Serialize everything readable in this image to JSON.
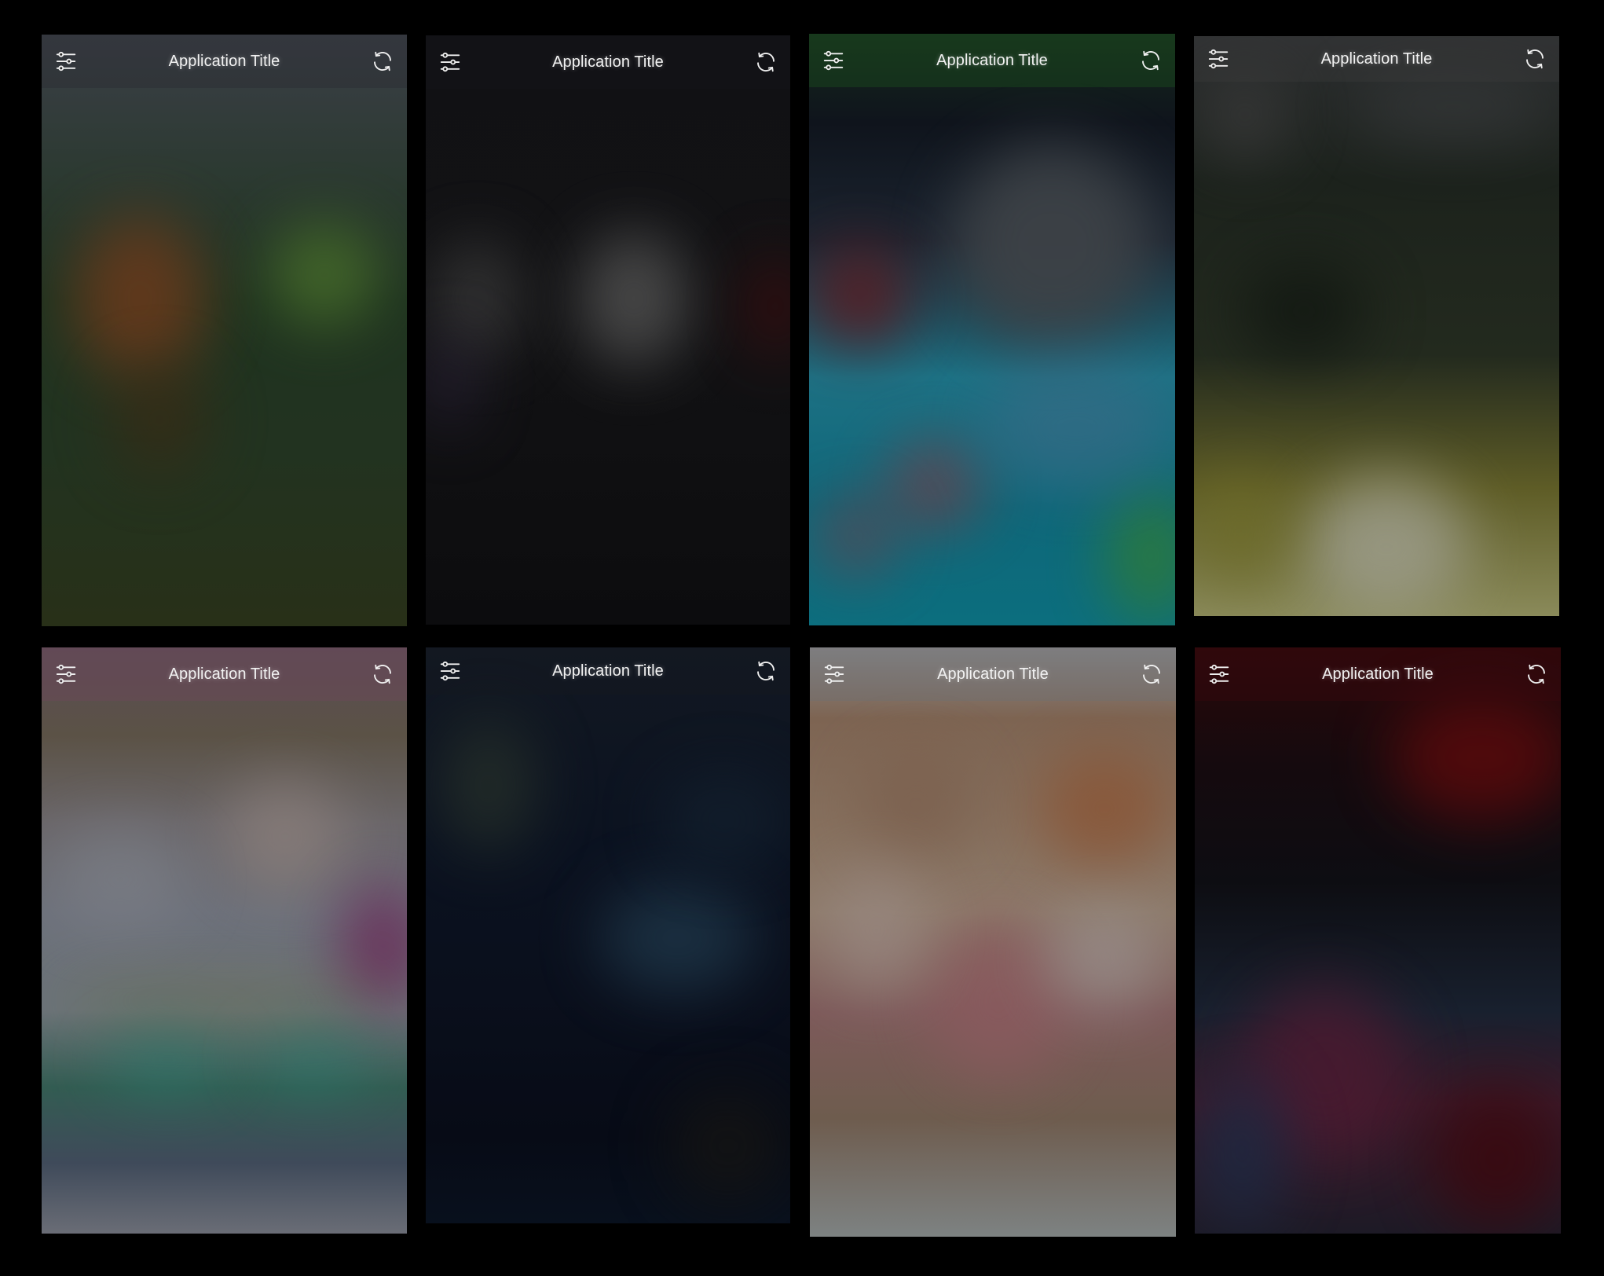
{
  "screens": [
    {
      "title": "Application Title",
      "left_icon": "sliders-icon",
      "right_icon": "refresh-icon"
    },
    {
      "title": "Application Title",
      "left_icon": "sliders-icon",
      "right_icon": "refresh-icon"
    },
    {
      "title": "Application Title",
      "left_icon": "sliders-icon",
      "right_icon": "refresh-icon"
    },
    {
      "title": "Application Title",
      "left_icon": "sliders-icon",
      "right_icon": "refresh-icon"
    },
    {
      "title": "Application Title",
      "left_icon": "sliders-icon",
      "right_icon": "refresh-icon"
    },
    {
      "title": "Application Title",
      "left_icon": "sliders-icon",
      "right_icon": "refresh-icon"
    },
    {
      "title": "Application Title",
      "left_icon": "sliders-icon",
      "right_icon": "refresh-icon"
    },
    {
      "title": "Application Title",
      "left_icon": "sliders-icon",
      "right_icon": "refresh-icon"
    }
  ],
  "colors": {
    "page_background": "#000000",
    "title_text": "#f2f2f2",
    "icon_stroke": "#f0f0f0"
  }
}
